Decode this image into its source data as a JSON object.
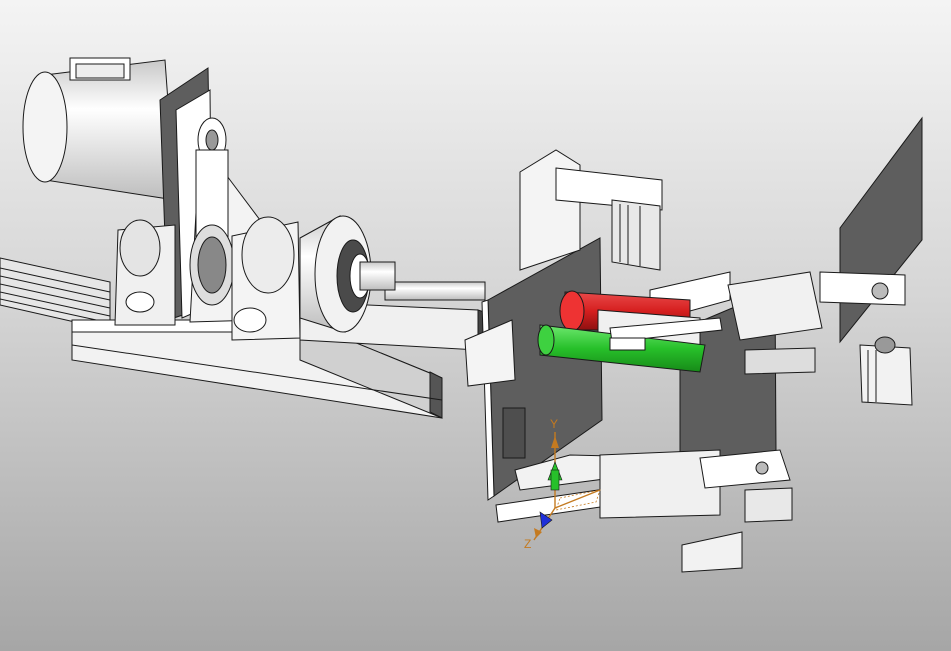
{
  "viewport": {
    "background_top": "#f4f4f4",
    "background_bottom": "#a6a6a6",
    "part_fill": "#ffffff",
    "part_shade": "#dcdcdc",
    "panel_fill": "#5e5e5e",
    "edge_color": "#1a1a1a",
    "highlight_red": "#d61f1f",
    "highlight_green": "#27c02a"
  },
  "triad": {
    "x_label": "",
    "y_label": "Y",
    "z_label": "Z",
    "axis_color": "#c47a20",
    "y_arrow_color": "#27c02a",
    "z_arrow_color": "#1f2fd8"
  }
}
